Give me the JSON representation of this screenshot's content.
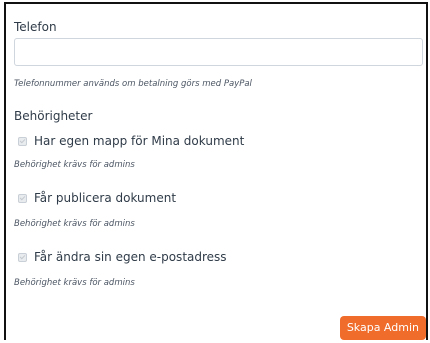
{
  "phone": {
    "label": "Telefon",
    "value": "",
    "placeholder": "",
    "hint": "Telefonnummer används om betalning görs med PayPal"
  },
  "permissions": {
    "heading": "Behörigheter",
    "items": [
      {
        "label": "Har egen mapp för Mina dokument",
        "checked": false,
        "disabled": true,
        "hint": "Behörighet krävs för admins"
      },
      {
        "label": "Får publicera dokument",
        "checked": false,
        "disabled": true,
        "hint": "Behörighet krävs för admins"
      },
      {
        "label": "Får ändra sin egen e-postadress",
        "checked": false,
        "disabled": true,
        "hint": "Behörighet krävs för admins"
      }
    ]
  },
  "actions": {
    "create_label": "Skapa Admin"
  },
  "colors": {
    "accent": "#ef6c2b",
    "text": "#2f3b48",
    "border": "#cfd6de"
  }
}
